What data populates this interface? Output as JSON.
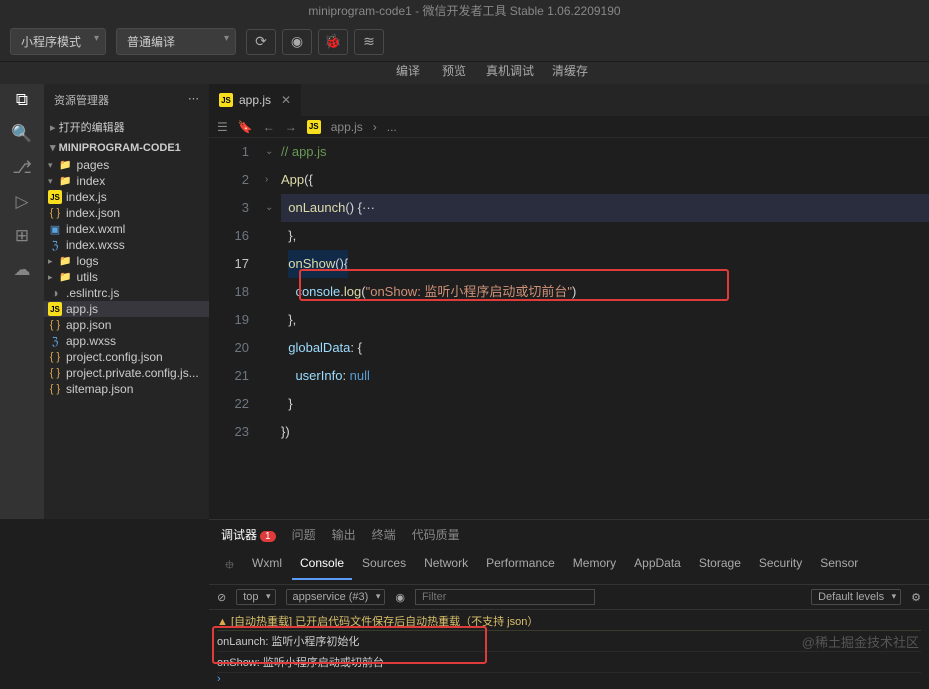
{
  "title": "miniprogram-code1 - 微信开发者工具 Stable 1.06.2209190",
  "toolbar": {
    "mode": "小程序模式",
    "compile": "普通编译",
    "sublabels": [
      "编译",
      "预览",
      "真机调试",
      "清缓存"
    ]
  },
  "sidebar": {
    "title": "资源管理器",
    "sections": {
      "openEditors": "打开的编辑器"
    },
    "project": "MINIPROGRAM-CODE1",
    "tree": {
      "pages": "pages",
      "index": "index",
      "index_js": "index.js",
      "index_json": "index.json",
      "index_wxml": "index.wxml",
      "index_wxss": "index.wxss",
      "logs": "logs",
      "utils": "utils",
      "eslintrc": ".eslintrc.js",
      "app_js": "app.js",
      "app_json": "app.json",
      "app_wxss": "app.wxss",
      "project_config": "project.config.json",
      "project_private": "project.private.config.js...",
      "sitemap": "sitemap.json"
    }
  },
  "editor": {
    "tab": "app.js",
    "breadcrumb": {
      "file": "app.js",
      "sep": "›",
      "more": "..."
    },
    "lineNumbers": [
      "1",
      "2",
      "3",
      "16",
      "17",
      "18",
      "19",
      "20",
      "21",
      "22",
      "23"
    ],
    "code": {
      "l1_comment": "// app.js",
      "l2": {
        "fn": "App",
        "p": "({"
      },
      "l3": {
        "fn": "onLaunch",
        "p1": "() {",
        "dots": "···"
      },
      "l16": "},",
      "l17": {
        "fn": "onShow",
        "p": "(){"
      },
      "l18": {
        "obj": "console",
        "m": "log",
        "s": "\"onShow: 监听小程序启动或切前台\"",
        "p1": "(",
        ".": ")"
      },
      "l19": "},",
      "l20": {
        "k": "globalData",
        "p": ": {"
      },
      "l21": {
        "k": "userInfo",
        "p": ": ",
        "v": "null"
      },
      "l22": "}",
      "l23": "})"
    }
  },
  "panel": {
    "tabs": {
      "debugger": "调试器",
      "badge": "1",
      "problems": "问题",
      "output": "输出",
      "terminal": "终端",
      "quality": "代码质量"
    },
    "devtools": [
      "Wxml",
      "Console",
      "Sources",
      "Network",
      "Performance",
      "Memory",
      "AppData",
      "Storage",
      "Security",
      "Sensor"
    ],
    "console": {
      "top": "top",
      "context": "appservice (#3)",
      "filterPlaceholder": "Filter",
      "levels": "Default levels",
      "warn": "[自动热重载] 已开启代码文件保存后自动热重载（不支持 json）",
      "log1": "onLaunch: 监听小程序初始化",
      "log2": "onShow: 监听小程序启动或切前台",
      "prompt": "›"
    }
  },
  "watermark": "@稀土掘金技术社区"
}
